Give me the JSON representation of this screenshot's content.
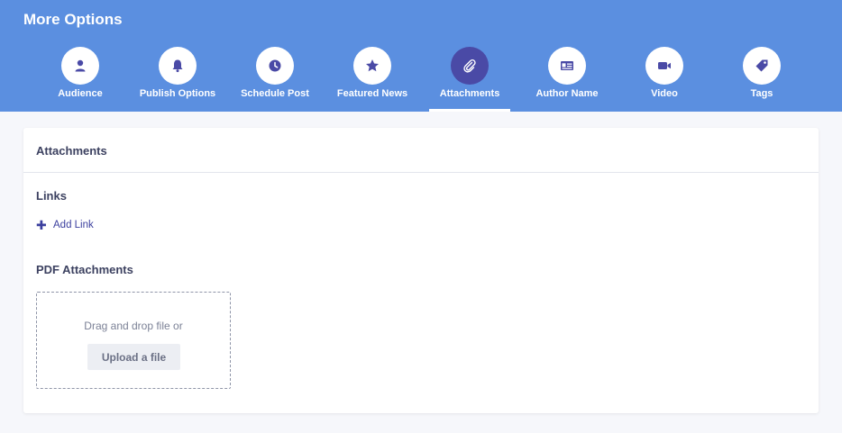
{
  "header": {
    "title": "More Options"
  },
  "tabs": [
    {
      "label": "Audience",
      "icon": "user-icon"
    },
    {
      "label": "Publish Options",
      "icon": "bell-icon"
    },
    {
      "label": "Schedule Post",
      "icon": "clock-icon"
    },
    {
      "label": "Featured News",
      "icon": "star-icon"
    },
    {
      "label": "Attachments",
      "icon": "paperclip-icon",
      "active": true
    },
    {
      "label": "Author Name",
      "icon": "id-card-icon"
    },
    {
      "label": "Video",
      "icon": "video-icon"
    },
    {
      "label": "Tags",
      "icon": "tag-icon"
    }
  ],
  "card": {
    "title": "Attachments",
    "links": {
      "title": "Links",
      "add_label": "Add Link"
    },
    "pdf": {
      "title": "PDF Attachments",
      "hint": "Drag and drop file or",
      "upload_label": "Upload a file"
    }
  },
  "colors": {
    "header_bg": "#5b8fe0",
    "icon": "#4a4aa6",
    "active_circle": "#4a4aa6",
    "link": "#3b3f9e"
  }
}
